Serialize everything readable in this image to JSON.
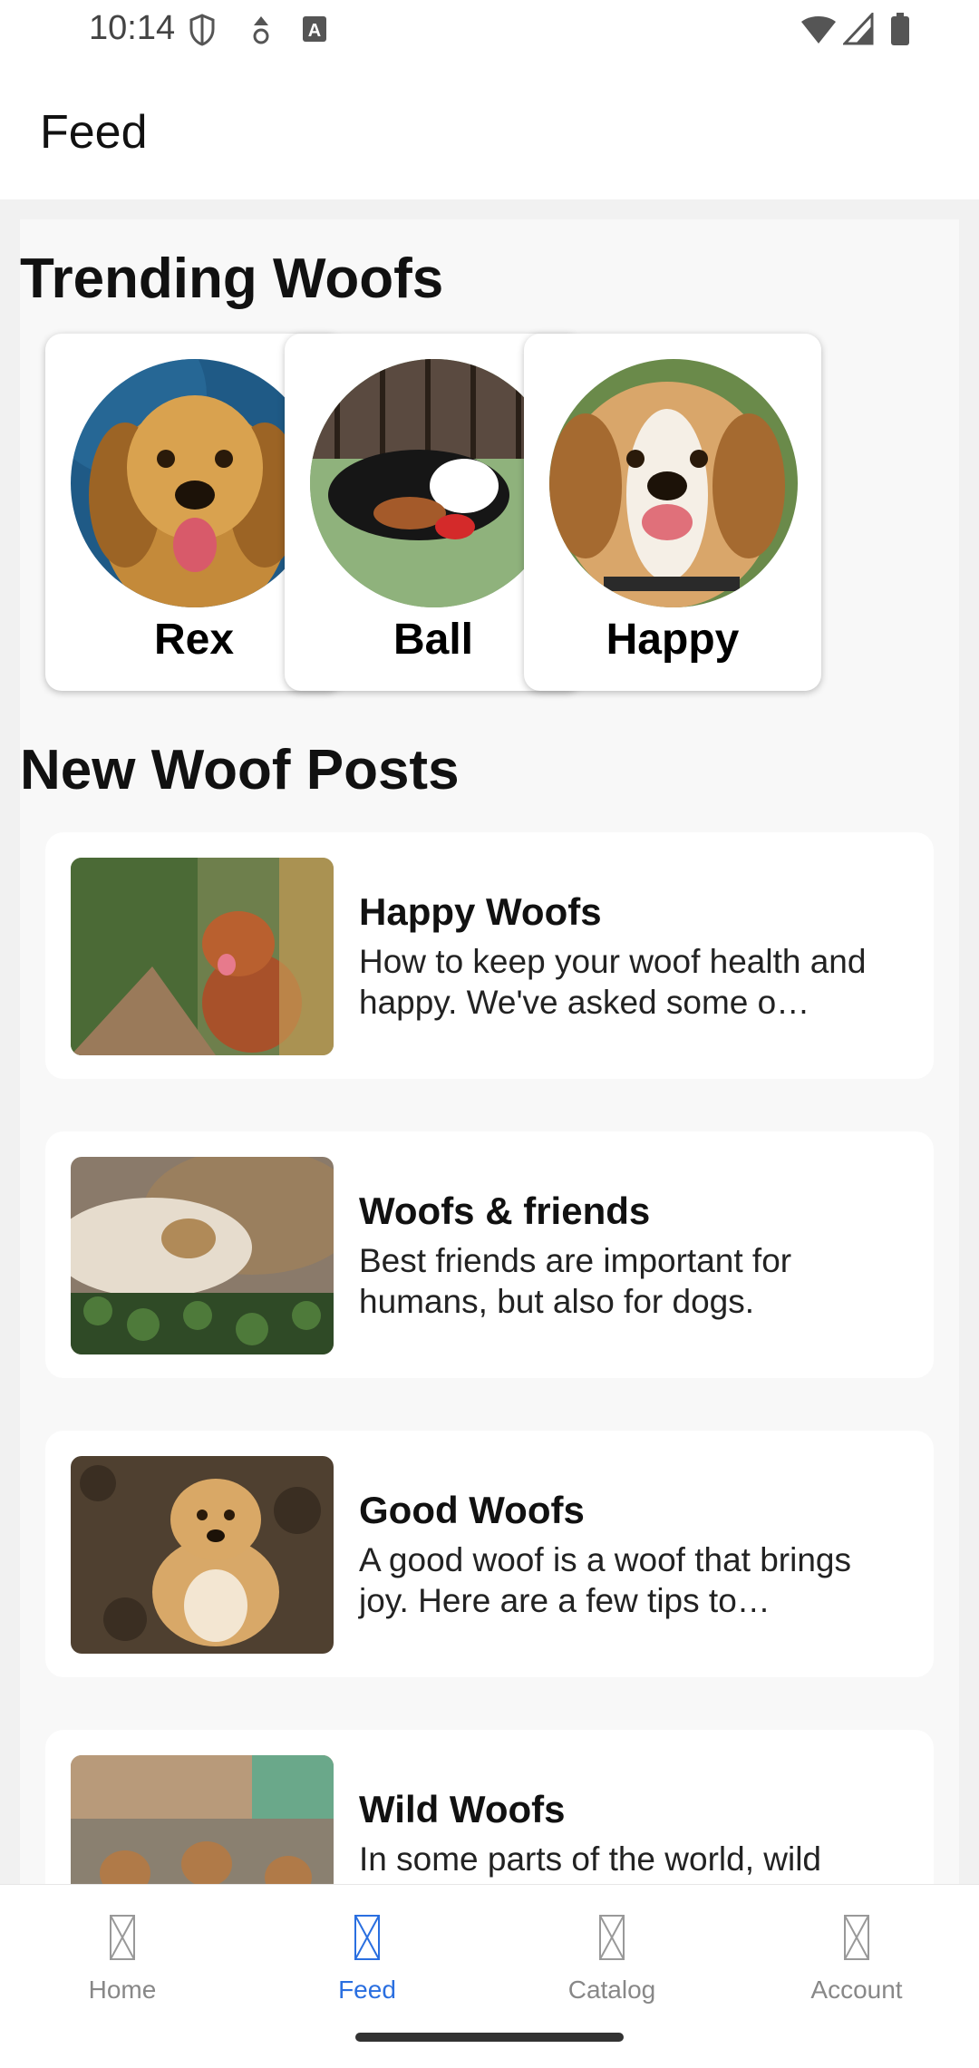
{
  "status_bar": {
    "time": "10:14",
    "icons_left": [
      "shield-icon",
      "data-saver-icon",
      "keyboard-a-icon"
    ],
    "icons_right": [
      "wifi-icon",
      "signal-icon",
      "battery-icon"
    ]
  },
  "app_bar": {
    "title": "Feed"
  },
  "trending": {
    "title": "Trending Woofs",
    "items": [
      {
        "name": "Rex",
        "image": "golden-retriever-photo"
      },
      {
        "name": "Ball",
        "image": "puppy-with-ball-photo"
      },
      {
        "name": "Happy",
        "image": "beagle-photo"
      }
    ]
  },
  "posts": {
    "title": "New Woof Posts",
    "items": [
      {
        "title": "Happy Woofs",
        "description": "How to keep your woof health and happy. We've asked some o…"
      },
      {
        "title": "Woofs & friends",
        "description": "Best friends are important for humans, but also for dogs."
      },
      {
        "title": "Good Woofs",
        "description": "A good woof is a woof that brings joy. Here are a few tips to…"
      },
      {
        "title": "Wild Woofs",
        "description": "In some parts of the world, wild"
      }
    ]
  },
  "bottom_nav": {
    "items": [
      {
        "label": "Home",
        "active": false
      },
      {
        "label": "Feed",
        "active": true
      },
      {
        "label": "Catalog",
        "active": false
      },
      {
        "label": "Account",
        "active": false
      }
    ],
    "active_color": "#2a6fe0",
    "inactive_color": "#888888"
  }
}
